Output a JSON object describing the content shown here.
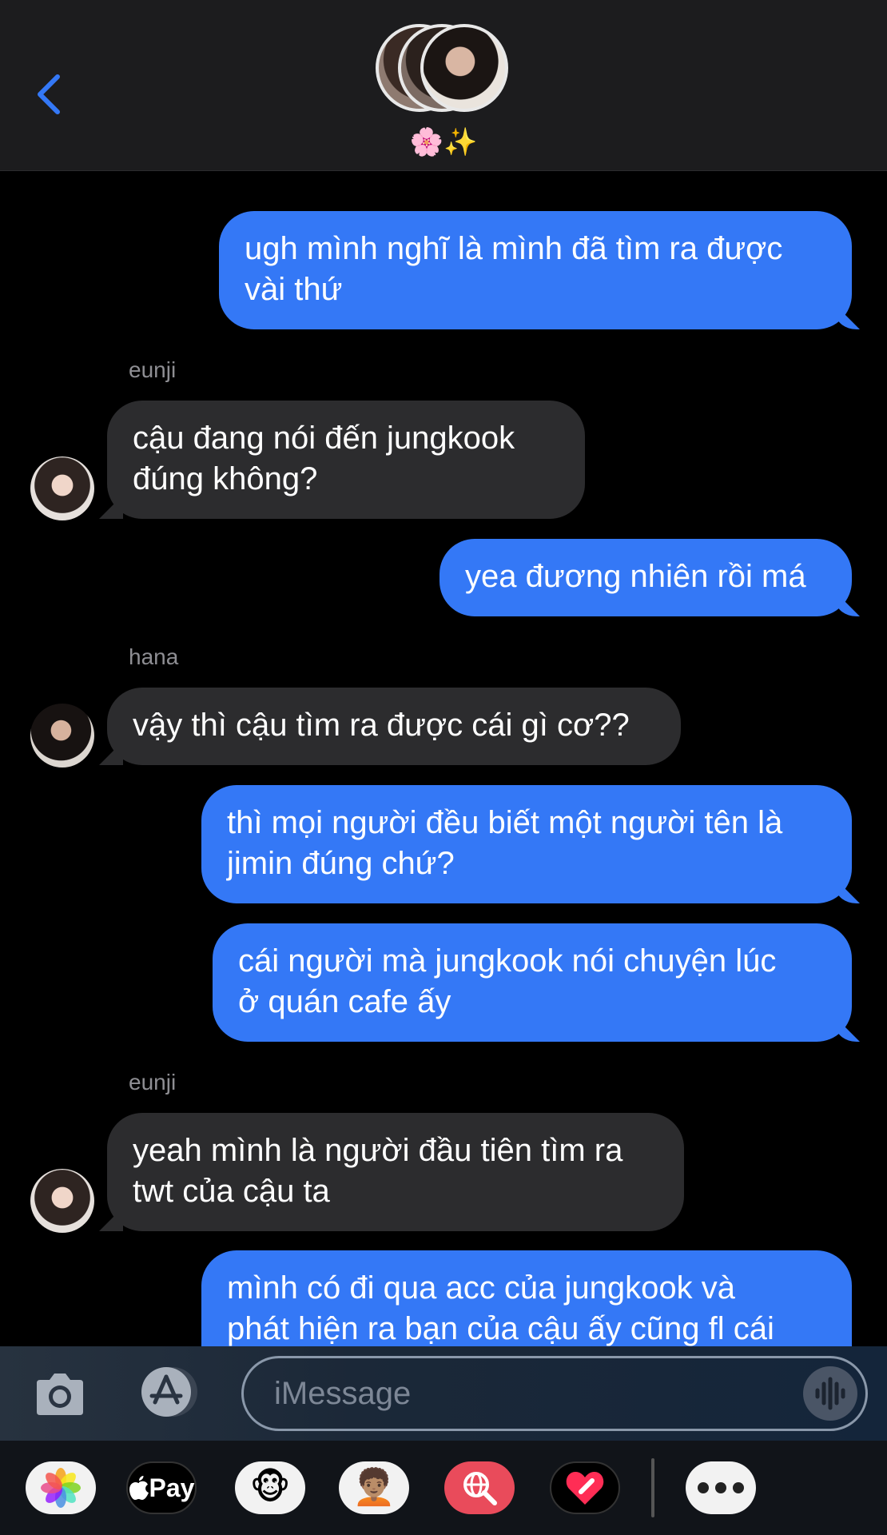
{
  "header": {
    "group_name": "🌸✨"
  },
  "thread": {
    "messages": [
      {
        "text_line1": "ugh mình nghĩ là mình đã tìm ra được",
        "text_line2": "vài thứ"
      },
      {
        "sender": "eunji",
        "text_line1": "cậu đang nói đến jungkook",
        "text_line2": "đúng không?"
      },
      {
        "text_line1": "yea đương nhiên rồi má"
      },
      {
        "sender": "hana",
        "text_line1": "vậy thì cậu tìm ra được cái gì cơ??"
      },
      {
        "text_line1": "thì mọi người đều biết một người tên là",
        "text_line2": "jimin đúng chứ?"
      },
      {
        "text_line1": "cái người mà jungkook nói chuyện lúc",
        "text_line2": "ở quán cafe ấy"
      },
      {
        "sender": "eunji",
        "text_line1": "yeah mình là người đầu tiên tìm ra",
        "text_line2": "twt của cậu ta"
      },
      {
        "text_line1": "mình có đi qua acc của jungkook và",
        "text_line2": "phát hiện ra bạn của cậu ấy cũng fl cái"
      }
    ]
  },
  "input": {
    "placeholder": "iMessage"
  },
  "drawer": {
    "apple_pay_label": "Pay",
    "animoji": "🐵",
    "memoji": "🧑🏽‍🦱"
  },
  "colors": {
    "outgoing": "#3478f6",
    "incoming": "#2c2c2e",
    "header": "#1c1c1e",
    "accent": "#3478f6"
  },
  "icons": [
    "back-chevron-icon",
    "camera-icon",
    "app-store-icon",
    "voice-waveform-icon",
    "photos-icon",
    "apple-pay-icon",
    "animoji-icon",
    "memoji-icon",
    "web-search-icon",
    "digital-touch-icon",
    "more-icon"
  ]
}
